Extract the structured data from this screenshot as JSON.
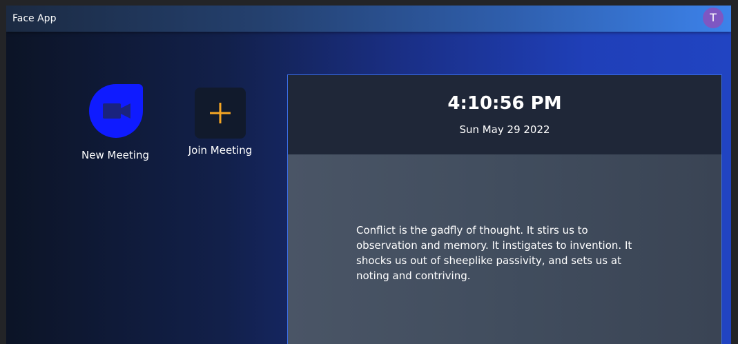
{
  "header": {
    "title": "Face App",
    "avatar_initial": "T"
  },
  "actions": {
    "new_meeting": {
      "label": "New Meeting",
      "icon": "video-camera-icon",
      "color": "#0f1bff"
    },
    "join_meeting": {
      "label": "Join Meeting",
      "icon": "plus-icon",
      "color": "#f5a623"
    }
  },
  "clock": {
    "time": "4:10:56 PM",
    "date": "Sun May 29 2022"
  },
  "quote": {
    "text": "Conflict is the gadfly of thought. It stirs us to observation and memory. It instigates to invention. It shocks us out of sheeplike passivity, and sets us at noting and contriving."
  },
  "colors": {
    "avatar": "#7e57c2",
    "accent_border": "#3b6fe6"
  }
}
